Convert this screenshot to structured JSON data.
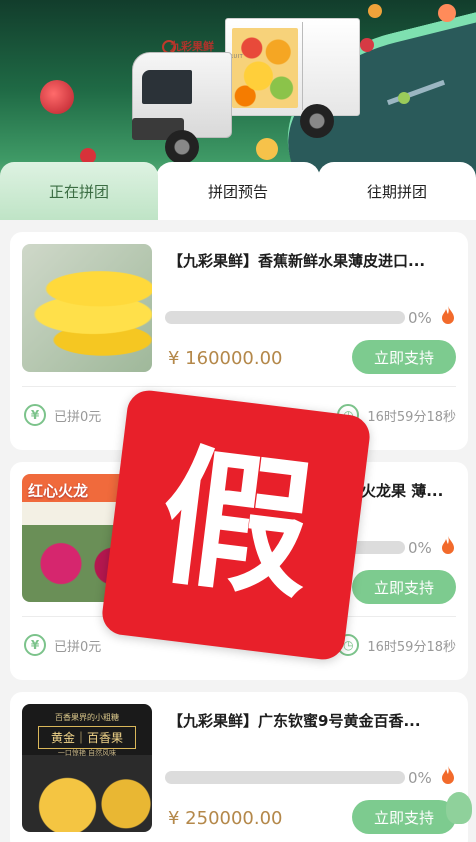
{
  "hero": {
    "brand_name": "九彩果鲜",
    "brand_subtitle": "JIUCAI FRESH FRUIT"
  },
  "tabs": [
    {
      "label": "正在拼团",
      "active": true
    },
    {
      "label": "拼团预告",
      "active": false
    },
    {
      "label": "往期拼团",
      "active": false
    }
  ],
  "products": [
    {
      "title": "【九彩果鲜】香蕉新鲜水果薄皮进口...",
      "progress_percent": 0,
      "progress_text": "0%",
      "price": "¥ 160000.00",
      "button": "立即支持",
      "joined": "已拼0元",
      "countdown": "16时59分18秒",
      "image_icon": "banana-image"
    },
    {
      "title": "红红心火龙果 薄...",
      "progress_percent": 0,
      "progress_text": "0%",
      "price": "",
      "button": "立即支持",
      "joined": "已拼0元",
      "countdown": "16时59分18秒",
      "image_icon": "dragon-fruit-image",
      "image_overlay_text": "红心火龙"
    },
    {
      "title": "【九彩果鲜】广东钦蜜9号黄金百香...",
      "progress_percent": 0,
      "progress_text": "0%",
      "price": "¥ 250000.00",
      "button": "立即支持",
      "image_icon": "passion-fruit-image",
      "image_top_text": "百香果界的小粗糖",
      "image_mid_text": "黄金｜百香果",
      "image_bottom_text": "一口惊艳 自然风味"
    }
  ],
  "stamp": {
    "text": "假",
    "color": "#e8202a"
  },
  "colors": {
    "accent_green": "#7dcb8f",
    "price": "#b4884a",
    "tab_active_bg": "#c8e8ce"
  }
}
